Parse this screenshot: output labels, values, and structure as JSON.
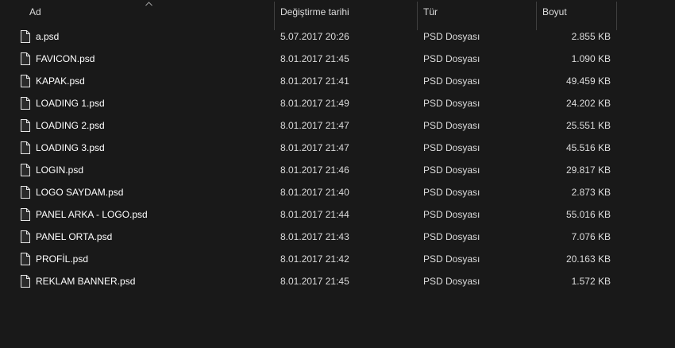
{
  "columns": {
    "name": "Ad",
    "date": "Değiştirme tarihi",
    "type": "Tür",
    "size": "Boyut"
  },
  "sort": {
    "column": "name",
    "direction": "ascending",
    "icon": "chevron-up-icon"
  },
  "files": [
    {
      "name": "a.psd",
      "date": "5.07.2017 20:26",
      "type": "PSD Dosyası",
      "size": "2.855 KB",
      "icon": "file-icon"
    },
    {
      "name": "FAVICON.psd",
      "date": "8.01.2017 21:45",
      "type": "PSD Dosyası",
      "size": "1.090 KB",
      "icon": "file-icon"
    },
    {
      "name": "KAPAK.psd",
      "date": "8.01.2017 21:41",
      "type": "PSD Dosyası",
      "size": "49.459 KB",
      "icon": "file-icon"
    },
    {
      "name": "LOADING 1.psd",
      "date": "8.01.2017 21:49",
      "type": "PSD Dosyası",
      "size": "24.202 KB",
      "icon": "file-icon"
    },
    {
      "name": "LOADING 2.psd",
      "date": "8.01.2017 21:47",
      "type": "PSD Dosyası",
      "size": "25.551 KB",
      "icon": "file-icon"
    },
    {
      "name": "LOADING 3.psd",
      "date": "8.01.2017 21:47",
      "type": "PSD Dosyası",
      "size": "45.516 KB",
      "icon": "file-icon"
    },
    {
      "name": "LOGIN.psd",
      "date": "8.01.2017 21:46",
      "type": "PSD Dosyası",
      "size": "29.817 KB",
      "icon": "file-icon"
    },
    {
      "name": "LOGO SAYDAM.psd",
      "date": "8.01.2017 21:40",
      "type": "PSD Dosyası",
      "size": "2.873 KB",
      "icon": "file-icon"
    },
    {
      "name": "PANEL ARKA - LOGO.psd",
      "date": "8.01.2017 21:44",
      "type": "PSD Dosyası",
      "size": "55.016 KB",
      "icon": "file-icon"
    },
    {
      "name": "PANEL ORTA.psd",
      "date": "8.01.2017 21:43",
      "type": "PSD Dosyası",
      "size": "7.076 KB",
      "icon": "file-icon"
    },
    {
      "name": "PROFİL.psd",
      "date": "8.01.2017 21:42",
      "type": "PSD Dosyası",
      "size": "20.163 KB",
      "icon": "file-icon"
    },
    {
      "name": "REKLAM BANNER.psd",
      "date": "8.01.2017 21:45",
      "type": "PSD Dosyası",
      "size": "1.572 KB",
      "icon": "file-icon"
    }
  ],
  "colors": {
    "background": "#191919",
    "text": "#ffffff",
    "secondary_text": "#dcdcdc",
    "separator": "#3f3f3f"
  }
}
